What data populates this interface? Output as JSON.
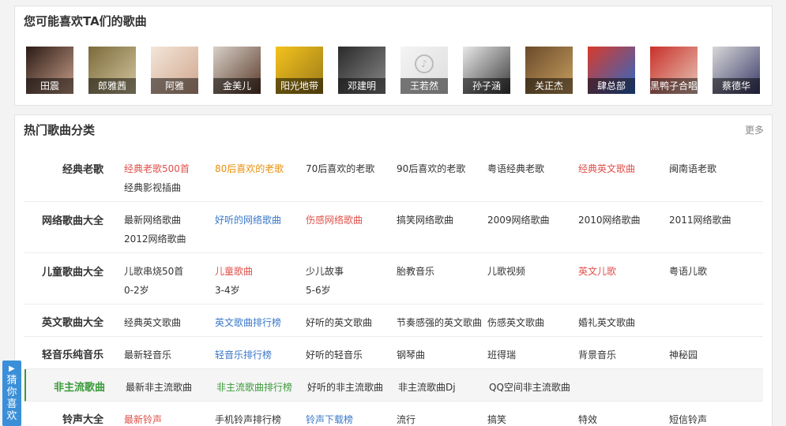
{
  "artists_section": {
    "title": "您可能喜欢TA们的歌曲",
    "artists": [
      {
        "name": "田震",
        "c1": "#2b1a15",
        "c2": "#c9a08a"
      },
      {
        "name": "郎雅茜",
        "c1": "#7b6a3a",
        "c2": "#d4c7a0"
      },
      {
        "name": "阿雅",
        "c1": "#f3e6da",
        "c2": "#d0a58c"
      },
      {
        "name": "金美儿",
        "c1": "#d8d0c8",
        "c2": "#5a3a2a"
      },
      {
        "name": "阳光地带",
        "c1": "#f4c21c",
        "c2": "#9a7a1a"
      },
      {
        "name": "邓建明",
        "c1": "#2a2a2a",
        "c2": "#8a8a8a"
      },
      {
        "name": "王若然",
        "c1": "#f4f4f4",
        "c2": "#dddddd",
        "placeholder": true
      },
      {
        "name": "孙子涵",
        "c1": "#e8e8e8",
        "c2": "#3a3a3a"
      },
      {
        "name": "关正杰",
        "c1": "#6a4a2a",
        "c2": "#c9a060"
      },
      {
        "name": "肆总部",
        "c1": "#d83a2a",
        "c2": "#2a6ac9"
      },
      {
        "name": "黑鸭子合唱",
        "c1": "#c9302a",
        "c2": "#e8c8b8"
      },
      {
        "name": "蔡德华",
        "c1": "#d8d8d8",
        "c2": "#3a3a6a"
      }
    ]
  },
  "categories_section": {
    "title": "热门歌曲分类",
    "more": "更多",
    "rows": [
      {
        "label": "经典老歌",
        "links": [
          {
            "text": "经典老歌500首",
            "color": "#e0504a"
          },
          {
            "text": "80后喜欢的老歌",
            "color": "#e8900a"
          },
          {
            "text": "70后喜欢的老歌",
            "color": "#333333"
          },
          {
            "text": "90后喜欢的老歌",
            "color": "#333333"
          },
          {
            "text": "粤语经典老歌",
            "color": "#333333"
          },
          {
            "text": "经典英文歌曲",
            "color": "#e0504a"
          },
          {
            "text": "闽南语老歌",
            "color": "#333333"
          },
          {
            "text": "经典影视插曲",
            "color": "#333333"
          }
        ]
      },
      {
        "label": "网络歌曲大全",
        "links": [
          {
            "text": "最新网络歌曲",
            "color": "#333333"
          },
          {
            "text": "好听的网络歌曲",
            "color": "#3a78c9"
          },
          {
            "text": "伤感网络歌曲",
            "color": "#e0504a"
          },
          {
            "text": "搞笑网络歌曲",
            "color": "#333333"
          },
          {
            "text": "2009网络歌曲",
            "color": "#333333"
          },
          {
            "text": "2010网络歌曲",
            "color": "#333333"
          },
          {
            "text": "2011网络歌曲",
            "color": "#333333"
          },
          {
            "text": "2012网络歌曲",
            "color": "#333333"
          }
        ]
      },
      {
        "label": "儿童歌曲大全",
        "links": [
          {
            "text": "儿歌串烧50首",
            "color": "#333333"
          },
          {
            "text": "儿童歌曲",
            "color": "#e0504a"
          },
          {
            "text": "少儿故事",
            "color": "#333333"
          },
          {
            "text": "胎教音乐",
            "color": "#333333"
          },
          {
            "text": "儿歌视频",
            "color": "#333333"
          },
          {
            "text": "英文儿歌",
            "color": "#e0504a"
          },
          {
            "text": "粤语儿歌",
            "color": "#333333"
          },
          {
            "text": "0-2岁",
            "color": "#333333"
          },
          {
            "text": "3-4岁",
            "color": "#333333"
          },
          {
            "text": "5-6岁",
            "color": "#333333"
          }
        ]
      },
      {
        "label": "英文歌曲大全",
        "links": [
          {
            "text": "经典英文歌曲",
            "color": "#333333"
          },
          {
            "text": "英文歌曲排行榜",
            "color": "#3a78c9"
          },
          {
            "text": "好听的英文歌曲",
            "color": "#333333"
          },
          {
            "text": "节奏感强的英文歌曲",
            "color": "#333333"
          },
          {
            "text": "伤感英文歌曲",
            "color": "#333333"
          },
          {
            "text": "婚礼英文歌曲",
            "color": "#333333"
          }
        ]
      },
      {
        "label": "轻音乐纯音乐",
        "links": [
          {
            "text": "最新轻音乐",
            "color": "#333333"
          },
          {
            "text": "轻音乐排行榜",
            "color": "#3a78c9"
          },
          {
            "text": "好听的轻音乐",
            "color": "#333333"
          },
          {
            "text": "钢琴曲",
            "color": "#333333"
          },
          {
            "text": "班得瑞",
            "color": "#333333"
          },
          {
            "text": "背景音乐",
            "color": "#333333"
          },
          {
            "text": "神秘园",
            "color": "#333333"
          }
        ]
      },
      {
        "label": "非主流歌曲",
        "highlight": true,
        "links": [
          {
            "text": "最新非主流歌曲",
            "color": "#333333"
          },
          {
            "text": "非主流歌曲排行榜",
            "color": "#3a9a3a"
          },
          {
            "text": "好听的非主流歌曲",
            "color": "#333333"
          },
          {
            "text": "非主流歌曲Dj",
            "color": "#333333"
          },
          {
            "text": "QQ空间非主流歌曲",
            "color": "#333333"
          }
        ]
      },
      {
        "label": "铃声大全",
        "links": [
          {
            "text": "最新铃声",
            "color": "#e0504a"
          },
          {
            "text": "手机铃声排行榜",
            "color": "#333333"
          },
          {
            "text": "铃声下载榜",
            "color": "#3a78c9"
          },
          {
            "text": "流行",
            "color": "#333333"
          },
          {
            "text": "搞笑",
            "color": "#333333"
          },
          {
            "text": "特效",
            "color": "#333333"
          },
          {
            "text": "短信铃声",
            "color": "#333333"
          }
        ]
      }
    ]
  },
  "side_tab": {
    "label": "猜你喜欢"
  }
}
